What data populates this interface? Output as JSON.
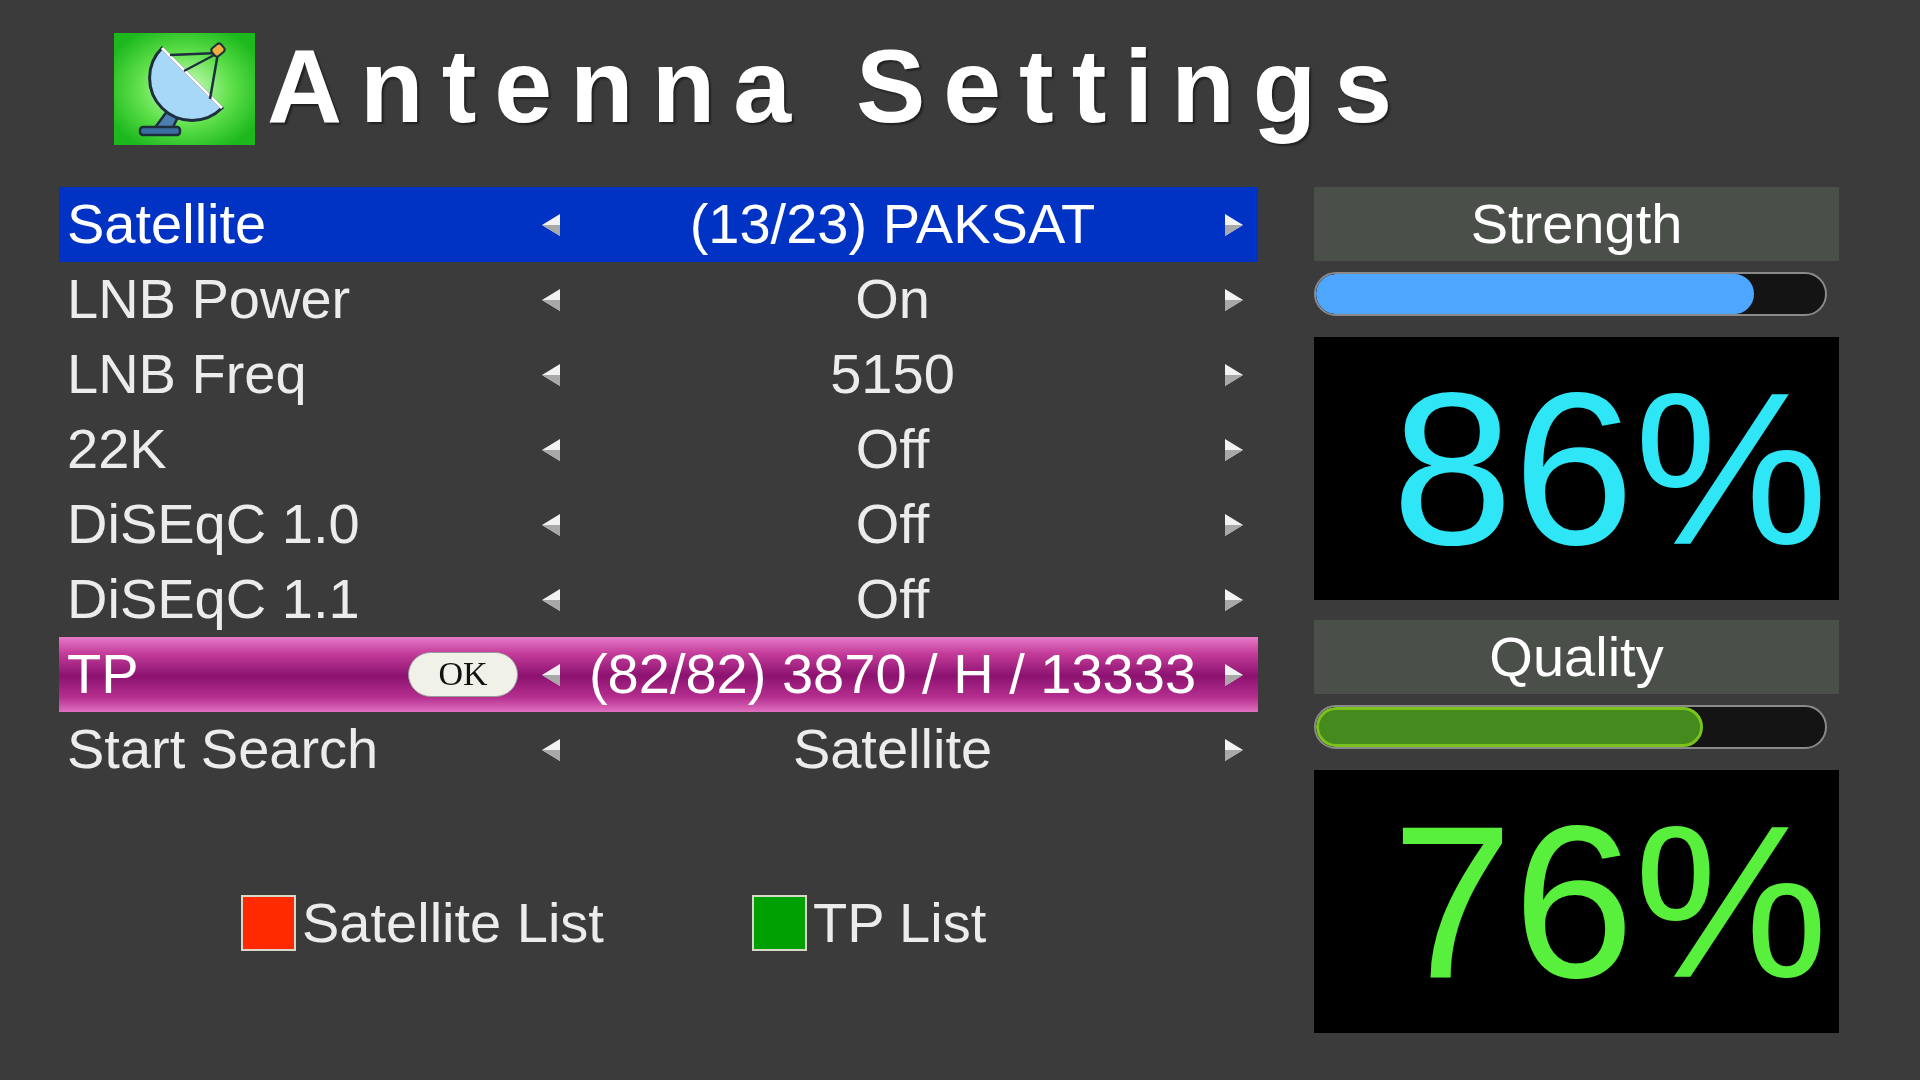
{
  "title": "Antenna Settings",
  "settings": [
    {
      "label": "Satellite",
      "value": "(13/23) PAKSAT",
      "selected": true,
      "highlighted": false
    },
    {
      "label": "LNB Power",
      "value": "On",
      "selected": false,
      "highlighted": false
    },
    {
      "label": "LNB Freq",
      "value": "5150",
      "selected": false,
      "highlighted": false
    },
    {
      "label": "22K",
      "value": "Off",
      "selected": false,
      "highlighted": false
    },
    {
      "label": "DiSEqC 1.0",
      "value": "Off",
      "selected": false,
      "highlighted": false
    },
    {
      "label": "DiSEqC 1.1",
      "value": "Off",
      "selected": false,
      "highlighted": false
    },
    {
      "label": "TP",
      "button": "OK",
      "value": "(82/82) 3870 / H / 13333",
      "selected": false,
      "highlighted": true
    },
    {
      "label": "Start Search",
      "value": "Satellite",
      "selected": false,
      "highlighted": false
    }
  ],
  "keys": [
    {
      "label": "Satellite List",
      "color": "#ff2a00"
    },
    {
      "label": "TP List",
      "color": "#00a000"
    }
  ],
  "meters": [
    {
      "kind": "strength",
      "label": "Strength",
      "level": 0.86,
      "reading": "86%"
    },
    {
      "kind": "quality",
      "label": "Quality",
      "level": 0.76,
      "reading": "76%"
    }
  ]
}
